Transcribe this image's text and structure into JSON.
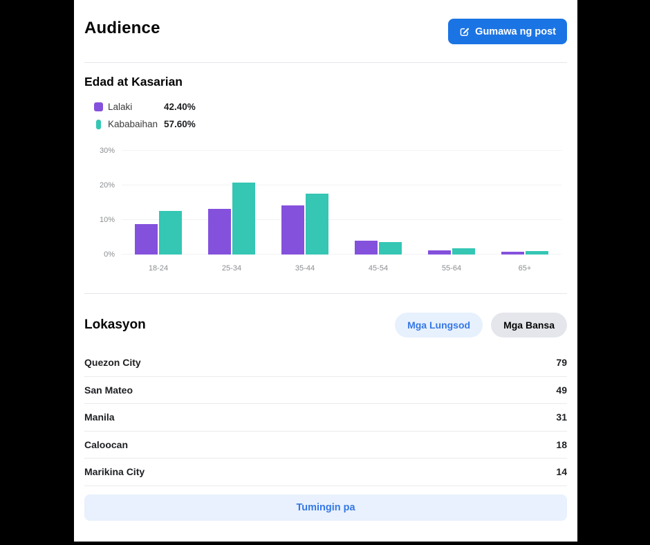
{
  "header": {
    "title": "Audience",
    "create_post_label": "Gumawa ng post"
  },
  "age_gender": {
    "title": "Edad at Kasarian",
    "legend": [
      {
        "label": "Lalaki",
        "value": "42.40%",
        "color": "#8451dd"
      },
      {
        "label": "Kababaihan",
        "value": "57.60%",
        "color": "#35c6b4"
      }
    ]
  },
  "chart_data": {
    "type": "bar",
    "categories": [
      "18-24",
      "25-34",
      "35-44",
      "45-54",
      "55-64",
      "65+"
    ],
    "series": [
      {
        "name": "Lalaki",
        "color": "#8451dd",
        "values": [
          8.8,
          13.3,
          14.2,
          4.0,
          1.2,
          0.9
        ]
      },
      {
        "name": "Kababaihan",
        "color": "#35c6b4",
        "values": [
          12.6,
          20.8,
          17.6,
          3.7,
          1.8,
          1.1
        ]
      }
    ],
    "title": "Edad at Kasarian",
    "xlabel": "",
    "ylabel": "",
    "ylim": [
      0,
      30
    ],
    "yticks": [
      0,
      10,
      20,
      30
    ],
    "ytick_labels": [
      "0%",
      "10%",
      "20%",
      "30%"
    ],
    "grid": true,
    "legend_position": "top-left"
  },
  "location": {
    "title": "Lokasyon",
    "tabs": [
      {
        "label": "Mga Lungsod",
        "active": true
      },
      {
        "label": "Mga Bansa",
        "active": false
      }
    ],
    "rows": [
      {
        "name": "Quezon City",
        "value": "79"
      },
      {
        "name": "San Mateo",
        "value": "49"
      },
      {
        "name": "Manila",
        "value": "31"
      },
      {
        "name": "Caloocan",
        "value": "18"
      },
      {
        "name": "Marikina City",
        "value": "14"
      }
    ],
    "see_more_label": "Tumingin pa"
  },
  "colors": {
    "accent_blue": "#1b74e4",
    "male_purple": "#8451dd",
    "female_teal": "#35c6b4",
    "pill_active_bg": "#e7f0fd",
    "pill_active_text": "#3578e5",
    "pill_inactive_bg": "#e4e6eb",
    "see_more_bg": "#e8f1fd",
    "background": "#000000"
  }
}
